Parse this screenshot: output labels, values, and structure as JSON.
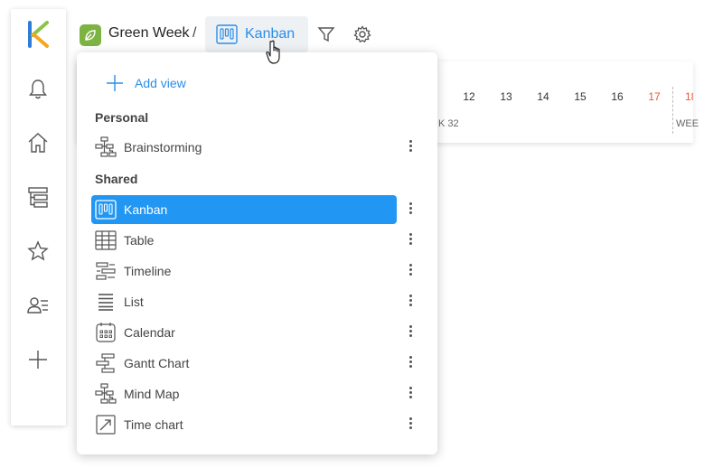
{
  "project": {
    "name": "Green Week",
    "separator": "/"
  },
  "current_view": {
    "label": "Kanban"
  },
  "timeline": {
    "days": [
      {
        "label": "12",
        "weekend": false
      },
      {
        "label": "13",
        "weekend": false
      },
      {
        "label": "14",
        "weekend": false
      },
      {
        "label": "15",
        "weekend": false
      },
      {
        "label": "16",
        "weekend": false
      },
      {
        "label": "17",
        "weekend": true
      },
      {
        "label": "18",
        "weekend": true
      }
    ],
    "week_label": "K 32",
    "week_label_2": "WEE"
  },
  "dropdown": {
    "add_view_label": "Add view",
    "personal_header": "Personal",
    "shared_header": "Shared",
    "personal_items": [
      {
        "label": "Brainstorming",
        "icon": "mindmap-icon"
      }
    ],
    "shared_items": [
      {
        "label": "Kanban",
        "icon": "kanban-icon",
        "active": true
      },
      {
        "label": "Table",
        "icon": "table-icon"
      },
      {
        "label": "Timeline",
        "icon": "timeline-icon"
      },
      {
        "label": "List",
        "icon": "list-icon"
      },
      {
        "label": "Calendar",
        "icon": "calendar-icon"
      },
      {
        "label": "Gantt Chart",
        "icon": "gantt-icon"
      },
      {
        "label": "Mind Map",
        "icon": "mindmap-icon"
      },
      {
        "label": "Time chart",
        "icon": "timechart-icon"
      }
    ]
  },
  "colors": {
    "accent": "#2196f3",
    "link": "#2a8ee8",
    "project": "#7cb342",
    "weekend": "#e8583a"
  }
}
